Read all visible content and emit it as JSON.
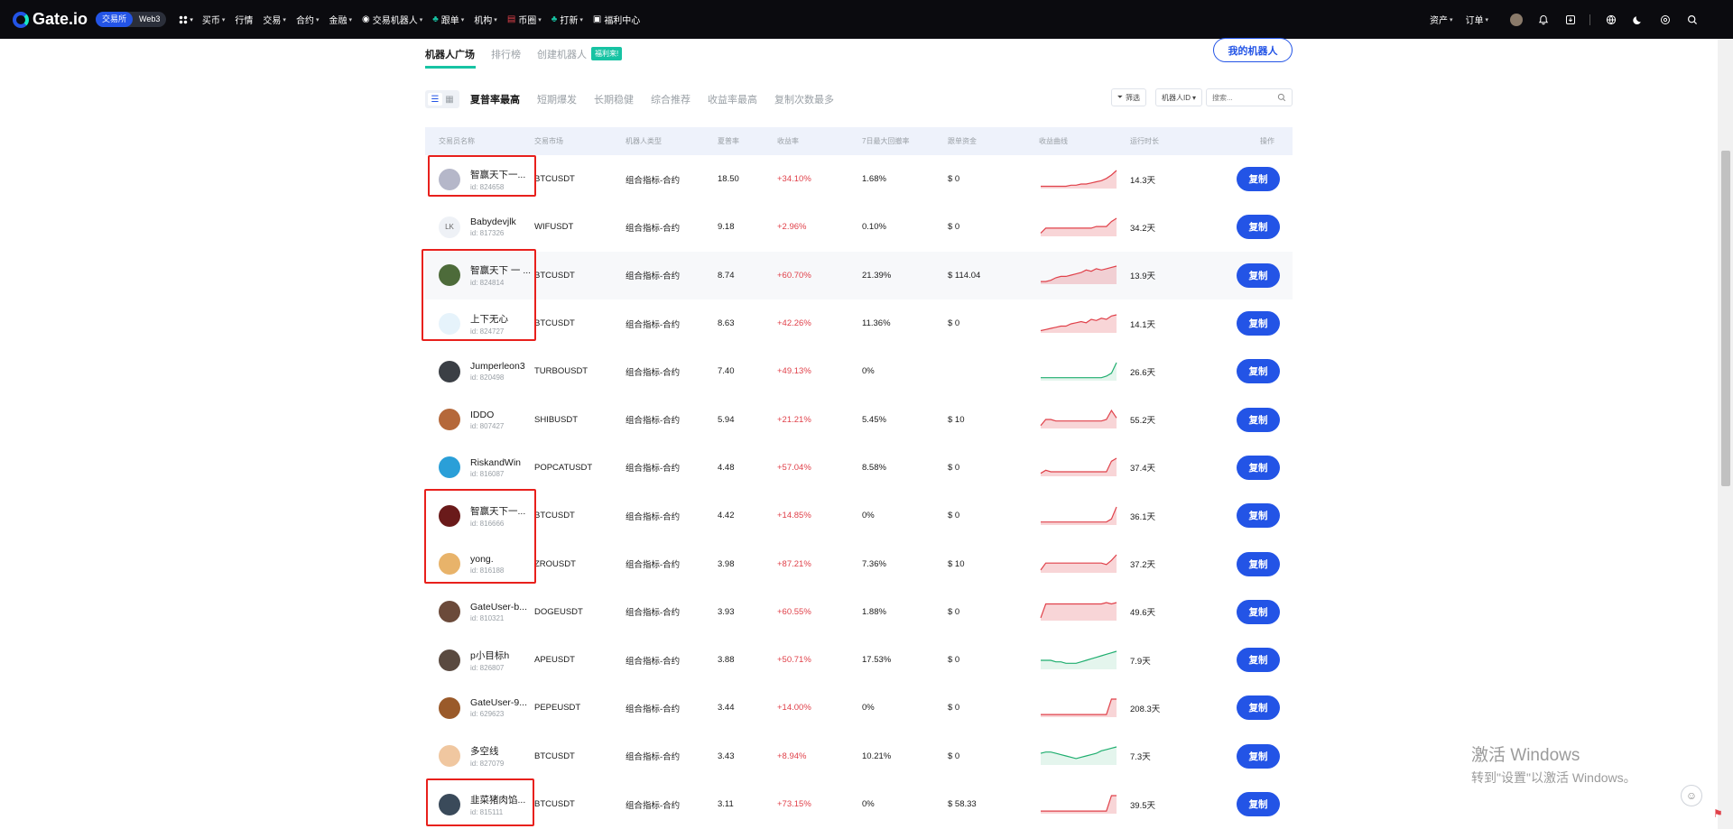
{
  "topbar": {
    "logo": "Gate.io",
    "exchange_tab": "交易所",
    "web3_tab": "Web3",
    "nav": [
      {
        "label": "买币",
        "caret": true,
        "icon": ""
      },
      {
        "label": "行情",
        "caret": false,
        "icon": ""
      },
      {
        "label": "交易",
        "caret": true,
        "icon": ""
      },
      {
        "label": "合约",
        "caret": true,
        "icon": ""
      },
      {
        "label": "金融",
        "caret": true,
        "icon": ""
      },
      {
        "label": "交易机器人",
        "caret": true,
        "icon": "bot-icon"
      },
      {
        "label": "跟单",
        "caret": true,
        "icon": "leaf-icon"
      },
      {
        "label": "机构",
        "caret": true,
        "icon": ""
      },
      {
        "label": "币圈",
        "caret": true,
        "icon": "chart-icon"
      },
      {
        "label": "打新",
        "caret": true,
        "icon": "leaf-icon"
      },
      {
        "label": "福利中心",
        "caret": false,
        "icon": "gift-icon"
      }
    ],
    "assets": "资产",
    "orders": "订单"
  },
  "tabs": {
    "plaza": "机器人广场",
    "ranking": "排行榜",
    "create": "创建机器人",
    "create_badge": "福利来!",
    "my_bots": "我的机器人"
  },
  "sorts": [
    "夏普率最高",
    "短期爆发",
    "长期稳健",
    "综合推荐",
    "收益率最高",
    "复制次数最多"
  ],
  "filter": {
    "filter_label": "筛选",
    "select_label": "机器人ID",
    "search_placeholder": "搜索..."
  },
  "table": {
    "headers": {
      "name": "交易员名称",
      "market": "交易市场",
      "type": "机器人类型",
      "ratio": "夏普率",
      "ret": "收益率",
      "dd": "7日最大回撤率",
      "fund": "跟单资金",
      "curve": "收益曲线",
      "time": "运行时长",
      "op": "操作"
    },
    "copy_label": "复制",
    "rows": [
      {
        "name": "智赢天下一...",
        "id": "id: 824658",
        "market": "BTCUSDT",
        "type": "组合指标-合约",
        "ratio": "18.50",
        "ret": "+34.10%",
        "dd": "1.68%",
        "fund": "$ 0",
        "time": "14.3天",
        "avatar_color": "#b5b7c9",
        "avatar_text": "",
        "curve": [
          2,
          2,
          2,
          2,
          2,
          2,
          3,
          3,
          4,
          4,
          5,
          6,
          7,
          9,
          12,
          16
        ],
        "curve_color": "#e0414a"
      },
      {
        "name": "Babydevjlk",
        "id": "id: 817326",
        "market": "WIFUSDT",
        "type": "组合指标-合约",
        "ratio": "9.18",
        "ret": "+2.96%",
        "dd": "0.10%",
        "fund": "$ 0",
        "time": "34.2天",
        "avatar_color": "#eef1f6",
        "avatar_text": "LK",
        "curve": [
          2,
          5,
          5,
          5,
          5,
          5,
          5,
          5,
          5,
          5,
          5,
          6,
          6,
          6,
          9,
          11
        ],
        "curve_color": "#e0414a"
      },
      {
        "name": "智赢天下 一 ...",
        "id": "id: 824814",
        "market": "BTCUSDT",
        "type": "组合指标-合约",
        "ratio": "8.74",
        "ret": "+60.70%",
        "dd": "21.39%",
        "fund": "$ 114.04",
        "time": "13.9天",
        "avatar_color": "#4d6b3a",
        "avatar_text": "",
        "curve": [
          2,
          2,
          3,
          5,
          6,
          6,
          7,
          8,
          9,
          11,
          10,
          12,
          11,
          12,
          13,
          14
        ],
        "curve_color": "#e0414a"
      },
      {
        "name": "上下无心",
        "id": "id: 824727",
        "market": "BTCUSDT",
        "type": "组合指标-合约",
        "ratio": "8.63",
        "ret": "+42.26%",
        "dd": "11.36%",
        "fund": "$ 0",
        "time": "14.1天",
        "avatar_color": "#e6f3fb",
        "avatar_text": "",
        "curve": [
          2,
          3,
          4,
          5,
          6,
          6,
          8,
          9,
          10,
          9,
          12,
          11,
          13,
          12,
          15,
          16
        ],
        "curve_color": "#e0414a"
      },
      {
        "name": "Jumperleon3",
        "id": "id: 820498",
        "market": "TURBOUSDT",
        "type": "组合指标-合约",
        "ratio": "7.40",
        "ret": "+49.13%",
        "dd": "0%",
        "fund": "",
        "time": "26.6天",
        "avatar_color": "#3b3f45",
        "avatar_text": "",
        "curve": [
          2,
          2,
          2,
          2,
          2,
          2,
          2,
          2,
          2,
          2,
          2,
          2,
          2,
          3,
          5,
          12
        ],
        "curve_color": "#1fae6f"
      },
      {
        "name": "IDDO",
        "id": "id: 807427",
        "market": "SHIBUSDT",
        "type": "组合指标-合约",
        "ratio": "5.94",
        "ret": "+21.21%",
        "dd": "5.45%",
        "fund": "$ 10",
        "time": "55.2天",
        "avatar_color": "#b5683a",
        "avatar_text": "",
        "curve": [
          2,
          6,
          6,
          5,
          5,
          5,
          5,
          5,
          5,
          5,
          5,
          5,
          5,
          6,
          12,
          7
        ],
        "curve_color": "#e0414a"
      },
      {
        "name": "RiskandWin",
        "id": "id: 816087",
        "market": "POPCATUSDT",
        "type": "组合指标-合约",
        "ratio": "4.48",
        "ret": "+57.04%",
        "dd": "8.58%",
        "fund": "$ 0",
        "time": "37.4天",
        "avatar_color": "#2a9fd8",
        "avatar_text": "",
        "curve": [
          2,
          4,
          3,
          3,
          3,
          3,
          3,
          3,
          3,
          3,
          3,
          3,
          3,
          3,
          10,
          12
        ],
        "curve_color": "#e0414a"
      },
      {
        "name": "智赢天下一...",
        "id": "id: 816666",
        "market": "BTCUSDT",
        "type": "组合指标-合约",
        "ratio": "4.42",
        "ret": "+14.85%",
        "dd": "0%",
        "fund": "$ 0",
        "time": "36.1天",
        "avatar_color": "#6a1a1a",
        "avatar_text": "",
        "curve": [
          2,
          2,
          2,
          2,
          2,
          2,
          2,
          2,
          2,
          2,
          2,
          2,
          2,
          2,
          4,
          12
        ],
        "curve_color": "#e0414a"
      },
      {
        "name": "yong.",
        "id": "id: 816188",
        "market": "ZROUSDT",
        "type": "组合指标-合约",
        "ratio": "3.98",
        "ret": "+87.21%",
        "dd": "7.36%",
        "fund": "$ 10",
        "time": "37.2天",
        "avatar_color": "#e8b36a",
        "avatar_text": "",
        "curve": [
          2,
          7,
          7,
          7,
          7,
          7,
          7,
          7,
          7,
          7,
          7,
          7,
          7,
          6,
          9,
          13
        ],
        "curve_color": "#e0414a"
      },
      {
        "name": "GateUser-b...",
        "id": "id: 810321",
        "market": "DOGEUSDT",
        "type": "组合指标-合约",
        "ratio": "3.93",
        "ret": "+60.55%",
        "dd": "1.88%",
        "fund": "$ 0",
        "time": "49.6天",
        "avatar_color": "#6b4a3a",
        "avatar_text": "",
        "curve": [
          2,
          12,
          12,
          12,
          12,
          12,
          12,
          12,
          12,
          12,
          12,
          12,
          12,
          13,
          12,
          13
        ],
        "curve_color": "#e0414a"
      },
      {
        "name": "p小目标h",
        "id": "id: 826807",
        "market": "APEUSDT",
        "type": "组合指标-合约",
        "ratio": "3.88",
        "ret": "+50.71%",
        "dd": "17.53%",
        "fund": "$ 0",
        "time": "7.9天",
        "avatar_color": "#5a4a40",
        "avatar_text": "",
        "curve": [
          6,
          6,
          6,
          5,
          5,
          4,
          4,
          4,
          5,
          6,
          7,
          8,
          9,
          10,
          11,
          12
        ],
        "curve_color": "#1fae6f"
      },
      {
        "name": "GateUser-9...",
        "id": "id: 629623",
        "market": "PEPEUSDT",
        "type": "组合指标-合约",
        "ratio": "3.44",
        "ret": "+14.00%",
        "dd": "0%",
        "fund": "$ 0",
        "time": "208.3天",
        "avatar_color": "#9a5a2a",
        "avatar_text": "",
        "curve": [
          2,
          2,
          2,
          2,
          2,
          2,
          2,
          2,
          2,
          2,
          2,
          2,
          2,
          2,
          14,
          14
        ],
        "curve_color": "#e0414a"
      },
      {
        "name": "多空线",
        "id": "id: 827079",
        "market": "BTCUSDT",
        "type": "组合指标-合约",
        "ratio": "3.43",
        "ret": "+8.94%",
        "dd": "10.21%",
        "fund": "$ 0",
        "time": "7.3天",
        "avatar_color": "#f0c7a0",
        "avatar_text": "",
        "curve": [
          9,
          10,
          10,
          9,
          8,
          7,
          6,
          5,
          6,
          7,
          8,
          9,
          11,
          12,
          13,
          14
        ],
        "curve_color": "#1fae6f"
      },
      {
        "name": "韭菜猪肉馅...",
        "id": "id: 815111",
        "market": "BTCUSDT",
        "type": "组合指标-合约",
        "ratio": "3.11",
        "ret": "+73.15%",
        "dd": "0%",
        "fund": "$ 58.33",
        "time": "39.5天",
        "avatar_color": "#3a4a5a",
        "avatar_text": "",
        "curve": [
          2,
          2,
          2,
          2,
          2,
          2,
          2,
          2,
          2,
          2,
          2,
          2,
          2,
          2,
          14,
          14
        ],
        "curve_color": "#e0414a"
      }
    ]
  },
  "watermark": {
    "line1": "激活 Windows",
    "line2": "转到\"设置\"以激活 Windows。"
  }
}
